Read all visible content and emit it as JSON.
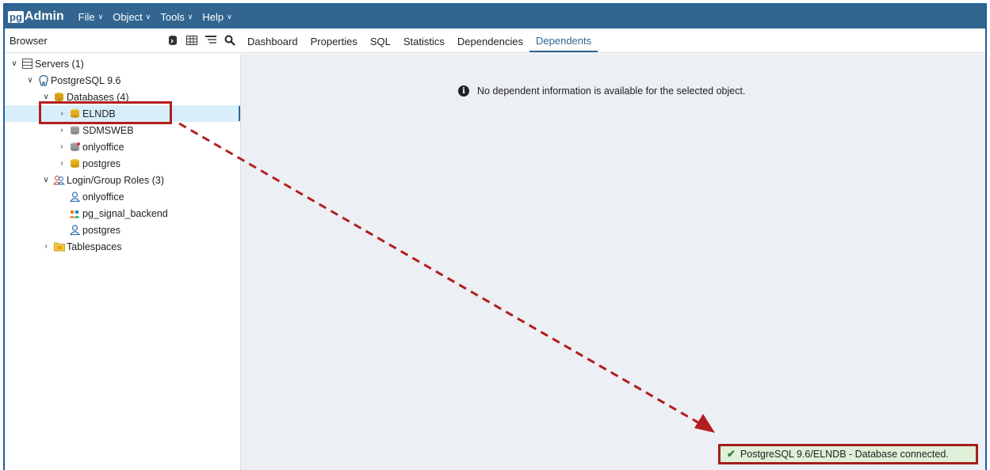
{
  "app": {
    "logo_pg": "pg",
    "logo_admin": "Admin",
    "menu": [
      {
        "label": "File"
      },
      {
        "label": "Object"
      },
      {
        "label": "Tools"
      },
      {
        "label": "Help"
      }
    ]
  },
  "browser": {
    "title": "Browser",
    "tools": [
      "query-tool-icon",
      "view-data-icon",
      "filter-rows-icon",
      "search-objects-icon"
    ]
  },
  "tabs": [
    {
      "label": "Dashboard"
    },
    {
      "label": "Properties"
    },
    {
      "label": "SQL"
    },
    {
      "label": "Statistics"
    },
    {
      "label": "Dependencies"
    },
    {
      "label": "Dependents",
      "active": true
    }
  ],
  "tree": {
    "servers": "Servers (1)",
    "server": "PostgreSQL 9.6",
    "databases": "Databases (4)",
    "db_elndb": "ELNDB",
    "db_sdmsweb": "SDMSWEB",
    "db_onlyoffice": "onlyoffice",
    "db_postgres": "postgres",
    "login_roles": "Login/Group Roles (3)",
    "role_onlyoffice": "onlyoffice",
    "role_pg_signal_backend": "pg_signal_backend",
    "role_postgres": "postgres",
    "tablespaces": "Tablespaces"
  },
  "content": {
    "info_message": "No dependent information is available for the selected object."
  },
  "toast": {
    "message": "PostgreSQL 9.6/ELNDB - Database connected."
  },
  "colors": {
    "topbar": "#326690",
    "selected_row": "#d9eefb",
    "content_bg": "#eceff3",
    "toast_bg": "#dff0d8",
    "annotation_red": "#b21e1e"
  }
}
